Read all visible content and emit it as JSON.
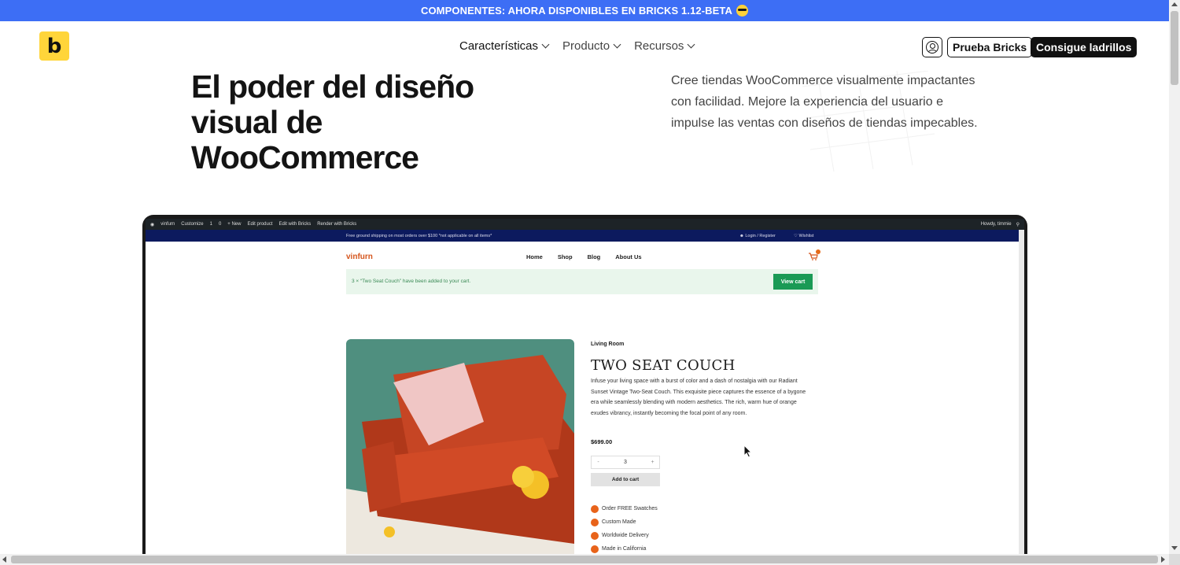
{
  "announcement": {
    "text": "COMPONENTES: AHORA DISPONIBLES EN BRICKS 1.12-BETA",
    "emoji": "sunglasses-emoji-icon"
  },
  "header": {
    "logo": "b",
    "nav": [
      {
        "label": "Características"
      },
      {
        "label": "Producto"
      },
      {
        "label": "Recursos"
      }
    ],
    "account_icon": "user-circle-icon",
    "try_label": "Prueba Bricks",
    "get_label": "Consigue ladrillos"
  },
  "hero": {
    "title_lines": [
      "El poder del diseño",
      "visual de",
      "WooCommerce"
    ],
    "description": "Cree tiendas WooCommerce visualmente impactantes con facilidad. Mejore la experiencia del usuario e impulse las ventas con diseños de tiendas impecables."
  },
  "mockup": {
    "admin_bar": {
      "items": [
        "vinfurn",
        "Customize",
        "1",
        "0",
        "+ New",
        "Edit product",
        "Edit with Bricks",
        "Render with Bricks"
      ],
      "greeting": "Howdy, timmie"
    },
    "shipping_msg": "Free ground shipping on most orders over $100 *not applicable on all items*",
    "login_label": "Login / Register",
    "wishlist_label": "Wishlist",
    "shop_logo": "vinfurn",
    "shop_nav": [
      "Home",
      "Shop",
      "Blog",
      "About Us"
    ],
    "notice_text": "3 × “Two Seat Couch” have been added to your cart.",
    "view_cart": "View cart",
    "product": {
      "category": "Living Room",
      "title": "TWO SEAT COUCH",
      "description": "Infuse your living space with a burst of color and a dash of nostalgia with our Radiant Sunset Vintage Two-Seat Couch. This exquisite piece captures the essence of a bygone era while seamlessly blending with modern aesthetics. The rich, warm hue of orange exudes vibrancy, instantly becoming the focal point of any room.",
      "price": "$699.00",
      "qty_minus": "-",
      "qty": "3",
      "qty_plus": "+",
      "add_to_cart": "Add to cart",
      "features": [
        "Order FREE Swatches",
        "Custom Made",
        "Worldwide Delivery",
        "Made in California"
      ]
    }
  },
  "colors": {
    "announce_bg": "#3d6ef5",
    "brand_yellow": "#ffd53a",
    "accent_orange": "#e8631a",
    "cart_green": "#1a9a55"
  }
}
